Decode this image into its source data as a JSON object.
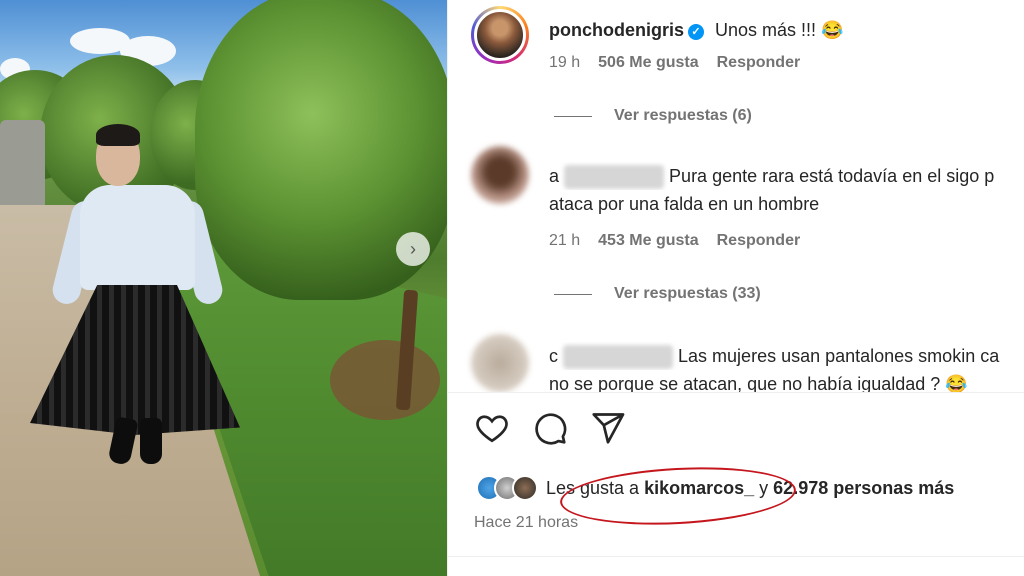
{
  "post": {
    "author": "ponchodenigris",
    "caption": "Unos más !!! 😂",
    "time_ago": "Hace 21 horas"
  },
  "comments": [
    {
      "time": "19 h",
      "likes": "506 Me gusta",
      "reply": "Responder",
      "view_replies": "Ver respuestas (6)"
    },
    {
      "prefix": "a",
      "text_line1": "Pura gente rara está todavía en el sigo p",
      "text_line2": "ataca por una falda en un hombre",
      "time": "21 h",
      "likes": "453 Me gusta",
      "reply": "Responder",
      "view_replies": "Ver respuestas (33)"
    },
    {
      "prefix": "c",
      "text_line1": "Las mujeres usan pantalones smokin ca",
      "text_line2": "no se porque se atacan, que no había igualdad ? 😂"
    }
  ],
  "likes": {
    "prefix": "Les gusta a ",
    "user": "kikomarcos_",
    "middle": " y ",
    "count": "62.978 personas más"
  },
  "icons": {
    "like": "heart-icon",
    "comment": "comment-icon",
    "share": "send-icon",
    "verified": "verified-badge-icon",
    "carousel": "chevron-right-icon"
  },
  "colors": {
    "annotation": "#c4161c",
    "verified": "#0095f6",
    "secondary_text": "#737373"
  }
}
